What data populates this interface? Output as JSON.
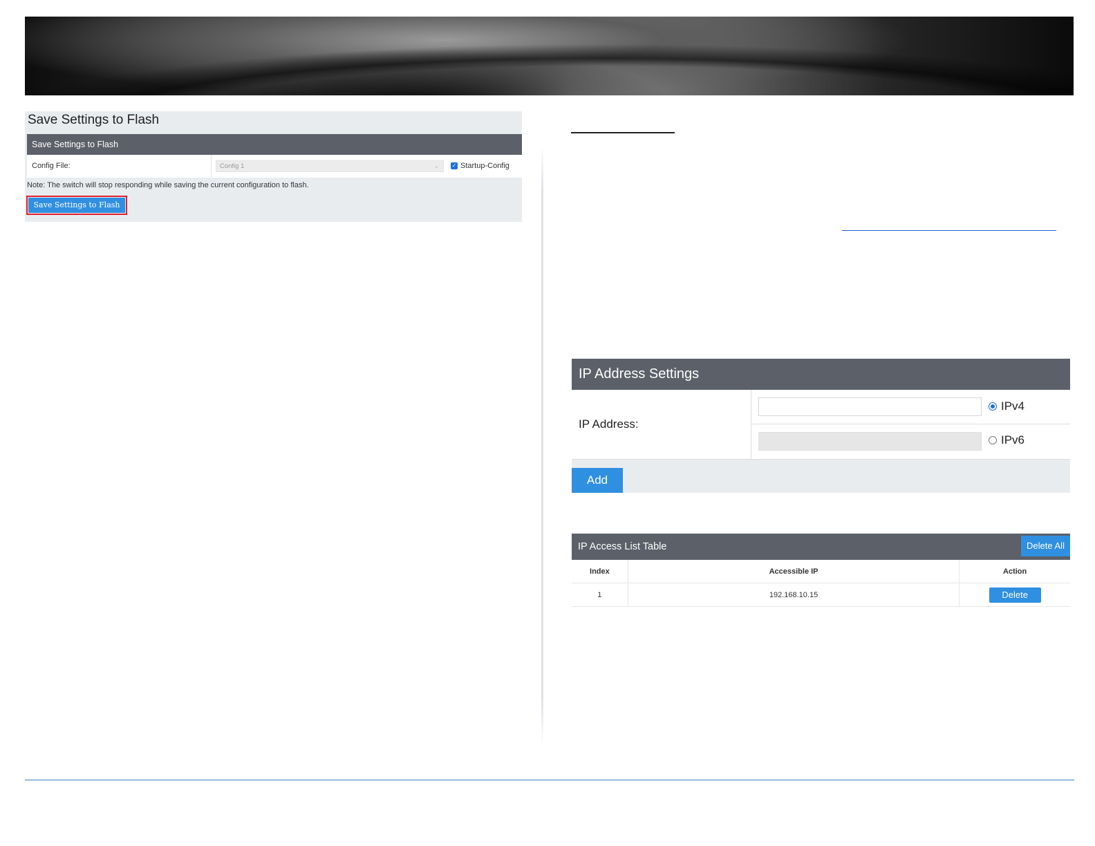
{
  "save_settings": {
    "page_title": "Save Settings to Flash",
    "header": "Save Settings to Flash",
    "config_file_label": "Config File:",
    "config_file_value": "Config 1",
    "startup_config_label": "Startup-Config",
    "startup_config_checked": true,
    "note": "Note: The switch will stop responding while saving the current configuration to flash.",
    "button_label": "Save Settings to Flash"
  },
  "ip_address_settings": {
    "header": "IP Address Settings",
    "ip_address_label": "IP Address:",
    "ipv4_value": "",
    "ipv6_value": "",
    "ipv4_label": "IPv4",
    "ipv6_label": "IPv6",
    "selected_version": "IPv4",
    "add_button": "Add"
  },
  "ip_access_list": {
    "header": "IP Access List Table",
    "delete_all_button": "Delete All",
    "columns": [
      "Index",
      "Accessible IP",
      "Action"
    ],
    "rows": [
      {
        "index": "1",
        "accessible_ip": "192.168.10.15",
        "action": "Delete"
      }
    ]
  },
  "colors": {
    "header_bg": "#5c6069",
    "button_blue": "#2f8fe0",
    "highlight_red": "#e0202d",
    "panel_bg": "#e9ecef"
  }
}
